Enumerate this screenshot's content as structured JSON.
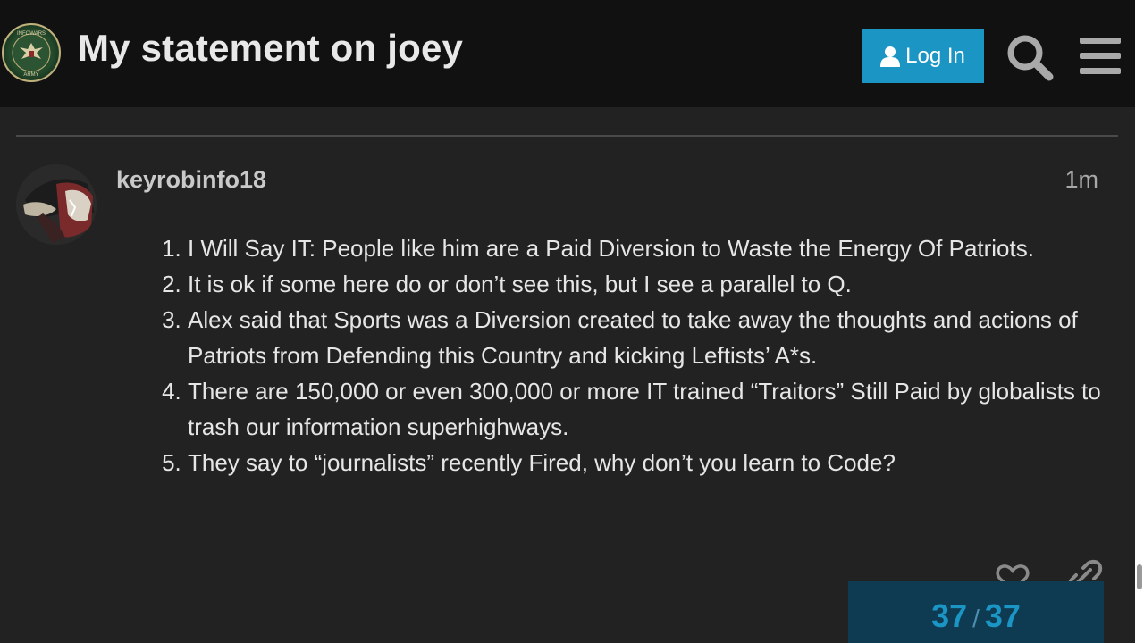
{
  "header": {
    "logo_text": "INFOWARS ARMY",
    "title": "My statement on joey",
    "login_label": "Log In",
    "login_icon": "user-icon",
    "search_icon": "search-icon",
    "menu_icon": "hamburger-menu-icon"
  },
  "post": {
    "username": "keyrobinfo18",
    "date": "1m",
    "items": [
      "I Will Say IT: People like him are a Paid Diversion to Waste the Energy Of Patriots.",
      "It is ok if some here do or don’t see this, but I see a parallel to Q.",
      "Alex said that Sports was a Diversion created to take away the thoughts and actions of Patriots from Defending this Country and kicking Leftists’ A*s.",
      "There are 150,000 or even 300,000 or more IT trained “Traitors” Still Paid by globalists to trash our information superhighways.",
      "They say to “journalists” recently Fired, why don’t you learn to Code?"
    ],
    "actions": [
      "heart-icon",
      "link-icon"
    ]
  },
  "progress": {
    "current": "37",
    "separator": "/",
    "total": "37",
    "fraction": 1.0
  },
  "colors": {
    "page_bg": "#222222",
    "header_bg": "#111111",
    "accent": "#1b95c4",
    "progress_bg": "#0e3a52"
  }
}
